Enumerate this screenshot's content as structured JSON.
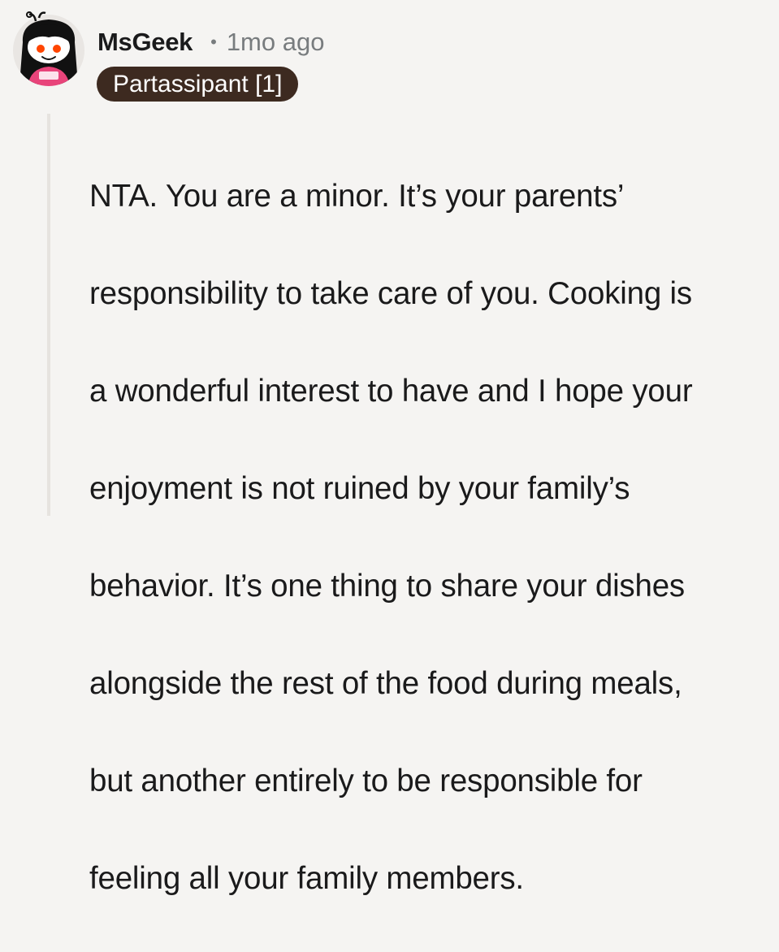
{
  "comment": {
    "author": "MsGeek",
    "separator": "•",
    "timestamp": "1mo ago",
    "flair": "Partassipant [1]",
    "avatar_icon": "snoo-avatar-icon",
    "body_lines": [
      "NTA. You are a minor. It’s your parents’",
      "responsibility to take care of you. Cooking is",
      "a wonderful interest to have and I hope your",
      "enjoyment is not ruined by your family’s",
      "behavior. It’s one thing to share your dishes",
      "alongside the rest of the food during meals,",
      "but another entirely to be responsible for",
      "feeling all your family members."
    ]
  },
  "colors": {
    "background": "#f5f4f2",
    "flair_background": "#3d2a20",
    "flair_text": "#ffffff",
    "meta_text": "#787c7e",
    "avatar_shirt": "#e8447a",
    "avatar_eyes": "#ff4500"
  }
}
